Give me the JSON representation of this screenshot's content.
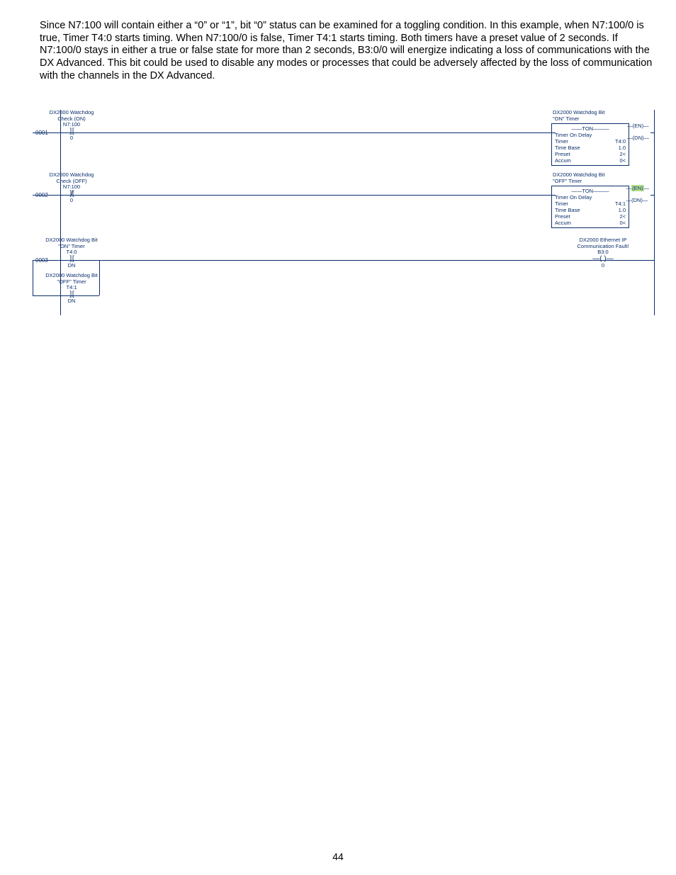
{
  "paragraph": "Since N7:100 will contain either a “0” or “1”, bit “0” status can be examined for a toggling condition. In this example, when N7:100/0 is true, Timer T4:0 starts timing. When N7:100/0 is false, Timer T4:1 starts timing. Both timers have a preset value of 2 seconds. If N7:100/0 stays in either a true or false state for more than 2 seconds, B3:0/0 will energize indicating a loss of communications with the DX Advanced. This bit could be used to disable any modes or processes that could be adversely affected by the loss of communication with the channels in the DX Advanced.",
  "rung_numbers": [
    "0001",
    "0002",
    "0003"
  ],
  "rung1": {
    "contact": {
      "desc1": "DX2000 Watchdog",
      "desc2": "Check (ON)",
      "address": "N7:100",
      "bit": "0"
    },
    "ton": {
      "title1": "DX2000 Watchdog Bit",
      "title2": "\"ON\" Timer",
      "header_label": "TON",
      "name": "Timer On Delay",
      "rows": {
        "Timer": "T4:0",
        "Time Base": "1.0",
        "Preset": "2<",
        "Accum": "0<"
      },
      "en": "(EN)",
      "dn": "(DN)"
    }
  },
  "rung2": {
    "contact": {
      "desc1": "DX2000 Watchdog",
      "desc2": "Check (OFF)",
      "address": "N7:100",
      "bit": "0"
    },
    "ton": {
      "title1": "DX2000 Watchdog Bit",
      "title2": "\"OFF\" Timer",
      "header_label": "TON",
      "name": "Timer On Delay",
      "rows": {
        "Timer": "T4:1",
        "Time Base": "1.0",
        "Preset": "2<",
        "Accum": "0<"
      },
      "en": "(EN)",
      "dn": "(DN)"
    }
  },
  "rung3": {
    "contact1": {
      "desc1": "DX2000 Watchdog Bit",
      "desc2": "\"ON\" Timer",
      "address": "T4:0",
      "bit": "DN"
    },
    "contact2": {
      "desc1": "DX2000 Watchdog Bit",
      "desc2": "\"OFF\" Timer",
      "address": "T4:1",
      "bit": "DN"
    },
    "output": {
      "desc1": "DX2000 Ethernet IP",
      "desc2": "Communication Fault!",
      "address": "B3:0",
      "bit": "0"
    }
  },
  "page_number": "44"
}
